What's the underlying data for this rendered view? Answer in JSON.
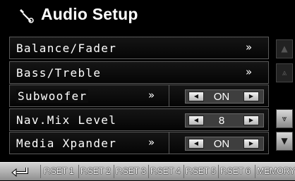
{
  "header": {
    "title": "Audio Setup",
    "icon": "wrench-icon"
  },
  "rows": [
    {
      "label": "Balance/Fader",
      "action": "»"
    },
    {
      "label": "Bass/Treble",
      "action": "»"
    },
    {
      "label": "Subwoofer",
      "action": "»",
      "value": "ON"
    },
    {
      "label": "Nav.Mix Level",
      "value": "8"
    },
    {
      "label": "Media Xpander",
      "action": "»",
      "value": "ON"
    }
  ],
  "stepper_arrows": {
    "left": "◀",
    "right": "▶"
  },
  "scroll": {
    "page_up": "▲",
    "up": "⩓",
    "down": "⩔",
    "page_down": "▼"
  },
  "footer": {
    "presets": [
      "P.SET 1",
      "P.SET 2",
      "P.SET 3",
      "P.SET 4",
      "P.SET 5",
      "P.SET 6"
    ],
    "memory": "MEMORY"
  }
}
